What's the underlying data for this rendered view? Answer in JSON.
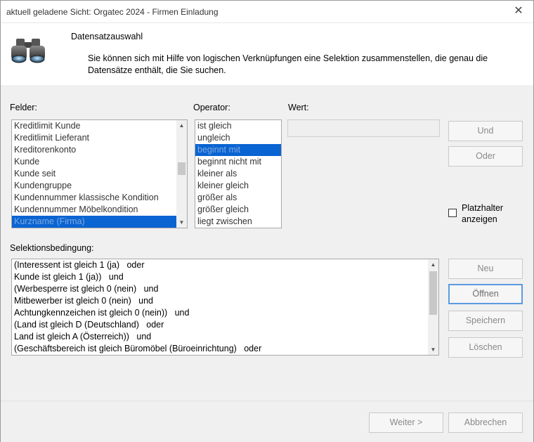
{
  "window": {
    "title": "aktuell geladene Sicht: Orgatec 2024 - Firmen Einladung",
    "close_symbol": "✕"
  },
  "header": {
    "title": "Datensatzauswahl",
    "description": "Sie können sich mit Hilfe von logischen Verknüpfungen eine Selektion zusammenstellen, die genau die Datensätze enthält, die Sie suchen.",
    "icon": "binoculars-icon"
  },
  "fields": {
    "label": "Felder:",
    "items": [
      "Kreditlimit Kunde",
      "Kreditlimit Lieferant",
      "Kreditorenkonto",
      "Kunde",
      "Kunde seit",
      "Kundengruppe",
      "Kundennummer klassische Kondition",
      "Kundennummer Möbelkondition",
      "Kurzname (Firma)"
    ],
    "selected_index": 8
  },
  "operator": {
    "label": "Operator:",
    "items": [
      "ist gleich",
      "ungleich",
      "beginnt mit",
      "beginnt nicht mit",
      "kleiner als",
      "kleiner gleich",
      "größer als",
      "größer gleich",
      "liegt zwischen"
    ],
    "selected_index": 2
  },
  "value": {
    "label": "Wert:",
    "current": ""
  },
  "buttons": {
    "und": "Und",
    "oder": "Oder",
    "neu": "Neu",
    "oeffnen": "Öffnen",
    "speichern": "Speichern",
    "loeschen": "Löschen",
    "weiter": "Weiter >",
    "abbrechen": "Abbrechen"
  },
  "placeholder_toggle": {
    "label_line1": "Platzhalter",
    "label_line2": "anzeigen",
    "checked": false
  },
  "selection": {
    "label": "Selektionsbedingung:",
    "lines": [
      "(Interessent ist gleich 1 (ja)   oder",
      "Kunde ist gleich 1 (ja))   und",
      "(Werbesperre ist gleich 0 (nein)   und",
      "Mitbewerber ist gleich 0 (nein)   und",
      "Achtungkennzeichen ist gleich 0 (nein))   und",
      "(Land ist gleich D (Deutschland)   oder",
      "Land ist gleich A (Österreich))   und",
      "(Geschäftsbereich ist gleich Büromöbel (Büroeinrichtung)   oder"
    ]
  },
  "colors": {
    "selection_highlight": "#0a64d2",
    "focus_border": "#5a9be0"
  }
}
